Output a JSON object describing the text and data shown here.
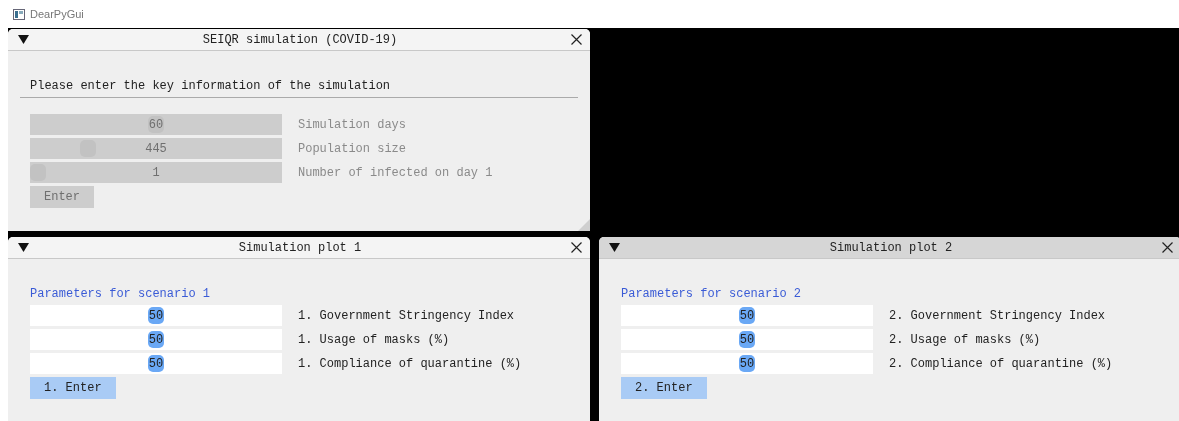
{
  "app_title": "DearPyGui",
  "windows": [
    {
      "title": "SEIQR simulation (COVID-19)",
      "active": false,
      "resizable": true,
      "heading": {
        "text": "Please enter the key information of the simulation",
        "kind": "separator"
      },
      "sliders": [
        {
          "value": "60",
          "label": "Simulation days",
          "level": 0.5,
          "disabled": true
        },
        {
          "value": "445",
          "label": "Population size",
          "level": 0.21,
          "disabled": true
        },
        {
          "value": "1",
          "label": "Number of infected on day 1",
          "level": 0,
          "disabled": true
        }
      ],
      "button": {
        "label": "Enter",
        "disabled": true
      }
    },
    {
      "title": "Simulation plot 1",
      "active": false,
      "heading": {
        "text": "Parameters for scenario 1",
        "kind": "note"
      },
      "sliders": [
        {
          "value": "50",
          "label": "1. Government Stringency Index",
          "level": 0.5,
          "disabled": false
        },
        {
          "value": "50",
          "label": "1. Usage of masks (%)",
          "level": 0.5,
          "disabled": false
        },
        {
          "value": "50",
          "label": "1. Compliance of quarantine (%)",
          "level": 0.5,
          "disabled": false
        }
      ],
      "button": {
        "label": "1. Enter",
        "disabled": false
      }
    },
    {
      "title": "Simulation plot 2",
      "active": true,
      "heading": {
        "text": "Parameters for scenario 2",
        "kind": "note"
      },
      "sliders": [
        {
          "value": "50",
          "label": "2. Government Stringency Index",
          "level": 0.5,
          "disabled": false
        },
        {
          "value": "50",
          "label": "2. Usage of masks (%)",
          "level": 0.5,
          "disabled": false
        },
        {
          "value": "50",
          "label": "2. Compliance of quarantine (%)",
          "level": 0.5,
          "disabled": false
        }
      ],
      "button": {
        "label": "2. Enter",
        "disabled": false
      }
    }
  ]
}
